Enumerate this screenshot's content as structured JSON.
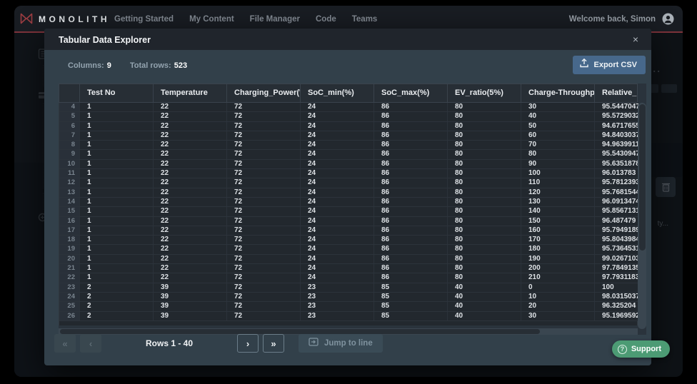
{
  "colors": {
    "accent_red": "#9c3d42",
    "export_blue": "#47688b",
    "support_green": "#4c9b74"
  },
  "nav": {
    "brand": "MONOLITH",
    "items": [
      "Getting Started",
      "My Content",
      "File Manager",
      "Code",
      "Teams"
    ],
    "welcome": "Welcome back, Simon"
  },
  "background": {
    "ellipsis": "...",
    "panel_text": "ty..."
  },
  "modal": {
    "title": "Tabular Data Explorer",
    "close": "×",
    "columns_label": "Columns:",
    "columns_value": "9",
    "total_rows_label": "Total rows:",
    "total_rows_value": "523",
    "export_label": "Export CSV",
    "table": {
      "headers": [
        "Test No",
        "Temperature",
        "Charging_Power(W)",
        "SoC_min(%)",
        "SoC_max(%)",
        "EV_ratio(5%)",
        "Charge-Throughp...",
        "Relative_res"
      ],
      "rows": [
        {
          "n": "4",
          "c": [
            "1",
            "22",
            "72",
            "24",
            "86",
            "80",
            "30",
            "95.5447047"
          ]
        },
        {
          "n": "5",
          "c": [
            "1",
            "22",
            "72",
            "24",
            "86",
            "80",
            "40",
            "95.5729032"
          ]
        },
        {
          "n": "6",
          "c": [
            "1",
            "22",
            "72",
            "24",
            "86",
            "80",
            "50",
            "94.6717655"
          ]
        },
        {
          "n": "7",
          "c": [
            "1",
            "22",
            "72",
            "24",
            "86",
            "80",
            "60",
            "94.8403037"
          ]
        },
        {
          "n": "8",
          "c": [
            "1",
            "22",
            "72",
            "24",
            "86",
            "80",
            "70",
            "94.9639911"
          ]
        },
        {
          "n": "9",
          "c": [
            "1",
            "22",
            "72",
            "24",
            "86",
            "80",
            "80",
            "95.5430947"
          ]
        },
        {
          "n": "10",
          "c": [
            "1",
            "22",
            "72",
            "24",
            "86",
            "80",
            "90",
            "95.6351878"
          ]
        },
        {
          "n": "11",
          "c": [
            "1",
            "22",
            "72",
            "24",
            "86",
            "80",
            "100",
            "96.013783"
          ]
        },
        {
          "n": "12",
          "c": [
            "1",
            "22",
            "72",
            "24",
            "86",
            "80",
            "110",
            "95.7812393"
          ]
        },
        {
          "n": "13",
          "c": [
            "1",
            "22",
            "72",
            "24",
            "86",
            "80",
            "120",
            "95.7681544"
          ]
        },
        {
          "n": "14",
          "c": [
            "1",
            "22",
            "72",
            "24",
            "86",
            "80",
            "130",
            "96.0913474"
          ]
        },
        {
          "n": "15",
          "c": [
            "1",
            "22",
            "72",
            "24",
            "86",
            "80",
            "140",
            "95.8567131"
          ]
        },
        {
          "n": "16",
          "c": [
            "1",
            "22",
            "72",
            "24",
            "86",
            "80",
            "150",
            "96.487479"
          ]
        },
        {
          "n": "17",
          "c": [
            "1",
            "22",
            "72",
            "24",
            "86",
            "80",
            "160",
            "95.7949189"
          ]
        },
        {
          "n": "18",
          "c": [
            "1",
            "22",
            "72",
            "24",
            "86",
            "80",
            "170",
            "95.8043984"
          ]
        },
        {
          "n": "19",
          "c": [
            "1",
            "22",
            "72",
            "24",
            "86",
            "80",
            "180",
            "95.7364531"
          ]
        },
        {
          "n": "20",
          "c": [
            "1",
            "22",
            "72",
            "24",
            "86",
            "80",
            "190",
            "99.0267103"
          ]
        },
        {
          "n": "21",
          "c": [
            "1",
            "22",
            "72",
            "24",
            "86",
            "80",
            "200",
            "97.7849135"
          ]
        },
        {
          "n": "22",
          "c": [
            "1",
            "22",
            "72",
            "24",
            "86",
            "80",
            "210",
            "97.7931183"
          ]
        },
        {
          "n": "23",
          "c": [
            "2",
            "39",
            "72",
            "23",
            "85",
            "40",
            "0",
            "100"
          ]
        },
        {
          "n": "24",
          "c": [
            "2",
            "39",
            "72",
            "23",
            "85",
            "40",
            "10",
            "98.0315037"
          ]
        },
        {
          "n": "25",
          "c": [
            "2",
            "39",
            "72",
            "23",
            "85",
            "40",
            "20",
            "96.325204"
          ]
        },
        {
          "n": "26",
          "c": [
            "2",
            "39",
            "72",
            "23",
            "85",
            "40",
            "30",
            "95.1969592"
          ]
        }
      ]
    },
    "pagination": {
      "first": "«",
      "prev": "‹",
      "range": "Rows 1 - 40",
      "next": "›",
      "last": "»",
      "jump": "Jump to line"
    }
  },
  "support": "Support"
}
